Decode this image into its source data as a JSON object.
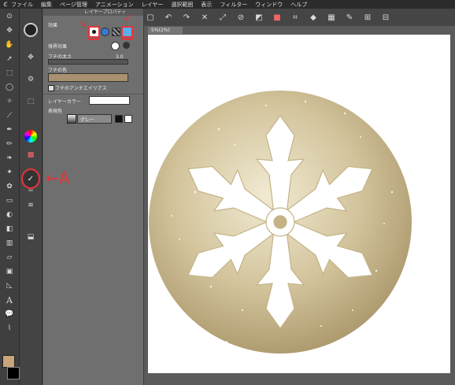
{
  "menu": {
    "logo": "ℭ",
    "items": [
      "ファイル",
      "編集",
      "ページ管理",
      "アニメーション",
      "レイヤー",
      "選択範囲",
      "表示",
      "フィルター",
      "ウィンドウ",
      "ヘルプ"
    ]
  },
  "panel": {
    "title": "レイヤープロパティ",
    "effect_label": "効果",
    "border_effect_label": "境界効果",
    "border_width_label": "フチの太さ",
    "border_width_value": "3.0",
    "border_color_label": "フチの色",
    "antialias_label": "フチのアンチエイリアス",
    "layer_color_label": "レイヤーカラー",
    "expression_color_label": "表現色",
    "expression_color_value": "グレー"
  },
  "canvas": {
    "tab_label": "5%(2%)"
  },
  "annotation": {
    "label": "←A"
  },
  "colors": {
    "border_color_swatch": "#a8916f",
    "main_color": "#c9a57a",
    "annotation_red": "#e8333a",
    "ornament_gold": "#c9b98f"
  },
  "icons": {
    "tools": [
      "zoom-icon",
      "move-icon",
      "hand-icon",
      "rotate-icon",
      "select-icon",
      "lasso-icon",
      "wand-icon",
      "eyedropper-icon",
      "pen-icon",
      "pencil-icon",
      "brush-icon",
      "airbrush-icon",
      "decorate-icon",
      "eraser-icon",
      "blend-icon",
      "fill-icon",
      "gradient-icon",
      "figure-icon",
      "frame-icon",
      "ruler-icon",
      "text-icon",
      "balloon-icon",
      "line-icon",
      "correction-icon"
    ]
  }
}
